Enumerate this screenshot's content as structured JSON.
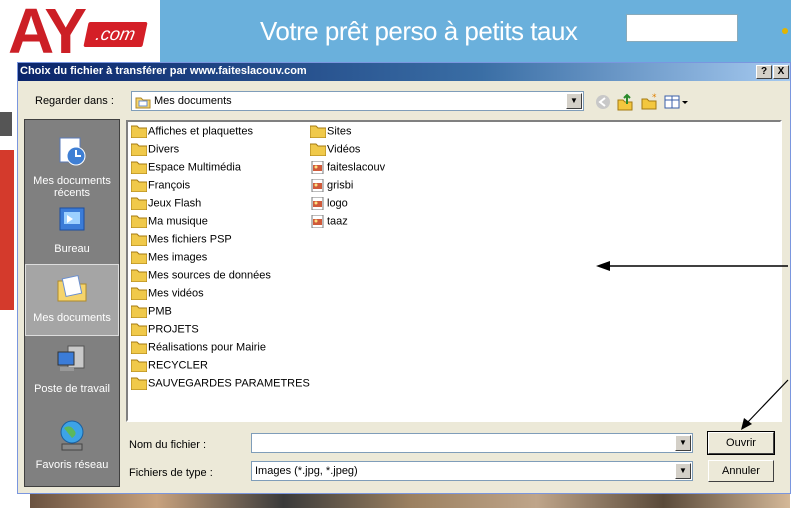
{
  "background": {
    "logo_text": "AY",
    "logo_suffix": ".com",
    "banner_ad": "Votre prêt perso à petits taux"
  },
  "dialog": {
    "title": "Choix du fichier à transférer par www.faiteslacouv.com",
    "help_button": "?",
    "close_button": "X",
    "look_in_label": "Regarder dans :",
    "look_in_value": "Mes documents",
    "file_name_label": "Nom du fichier :",
    "file_name_value": "",
    "file_type_label": "Fichiers de type :",
    "file_type_value": "Images (*.jpg, *.jpeg)",
    "open_button": "Ouvrir",
    "cancel_button": "Annuler"
  },
  "places": [
    {
      "label": "Mes documents récents",
      "icon": "recent-documents-icon"
    },
    {
      "label": "Bureau",
      "icon": "desktop-icon"
    },
    {
      "label": "Mes documents",
      "icon": "my-documents-icon"
    },
    {
      "label": "Poste de travail",
      "icon": "my-computer-icon"
    },
    {
      "label": "Favoris réseau",
      "icon": "network-places-icon"
    }
  ],
  "files_col1": [
    {
      "name": "Affiches et plaquettes",
      "type": "folder"
    },
    {
      "name": "Divers",
      "type": "folder"
    },
    {
      "name": "Espace Multimédia",
      "type": "folder"
    },
    {
      "name": "François",
      "type": "folder"
    },
    {
      "name": "Jeux Flash",
      "type": "folder"
    },
    {
      "name": "Ma musique",
      "type": "folder"
    },
    {
      "name": "Mes fichiers PSP",
      "type": "folder"
    },
    {
      "name": "Mes images",
      "type": "folder"
    },
    {
      "name": "Mes sources de données",
      "type": "folder"
    },
    {
      "name": "Mes vidéos",
      "type": "folder"
    },
    {
      "name": "PMB",
      "type": "folder"
    },
    {
      "name": "PROJETS",
      "type": "folder"
    },
    {
      "name": "Réalisations pour Mairie",
      "type": "folder"
    },
    {
      "name": "RECYCLER",
      "type": "folder"
    },
    {
      "name": "SAUVEGARDES PARAMETRES",
      "type": "folder"
    }
  ],
  "files_col2": [
    {
      "name": "Sites",
      "type": "folder"
    },
    {
      "name": "Vidéos",
      "type": "folder"
    },
    {
      "name": "faiteslacouv",
      "type": "image"
    },
    {
      "name": "grisbi",
      "type": "image"
    },
    {
      "name": "logo",
      "type": "image"
    },
    {
      "name": "taaz",
      "type": "image"
    }
  ],
  "colors": {
    "dialog_bg": "#ece9d8",
    "title_gradient_start": "#0a246a",
    "places_bg": "#808080",
    "folder": "#f0c94a"
  }
}
